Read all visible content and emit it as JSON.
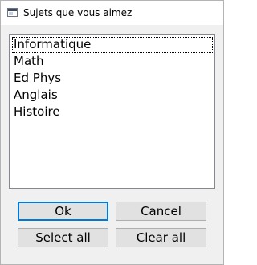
{
  "window": {
    "title": "Sujets que vous aimez"
  },
  "listbox": {
    "items": [
      {
        "label": "Informatique",
        "focused": true
      },
      {
        "label": "Math",
        "focused": false
      },
      {
        "label": "Ed Phys",
        "focused": false
      },
      {
        "label": "Anglais",
        "focused": false
      },
      {
        "label": "Histoire",
        "focused": false
      }
    ]
  },
  "buttons": {
    "ok_label": "Ok",
    "cancel_label": "Cancel",
    "select_all_label": "Select all",
    "clear_all_label": "Clear all"
  },
  "colors": {
    "default_button_border": "#0078d7",
    "button_face": "#e1e1e1",
    "dialog_background": "#f0f0f0"
  }
}
